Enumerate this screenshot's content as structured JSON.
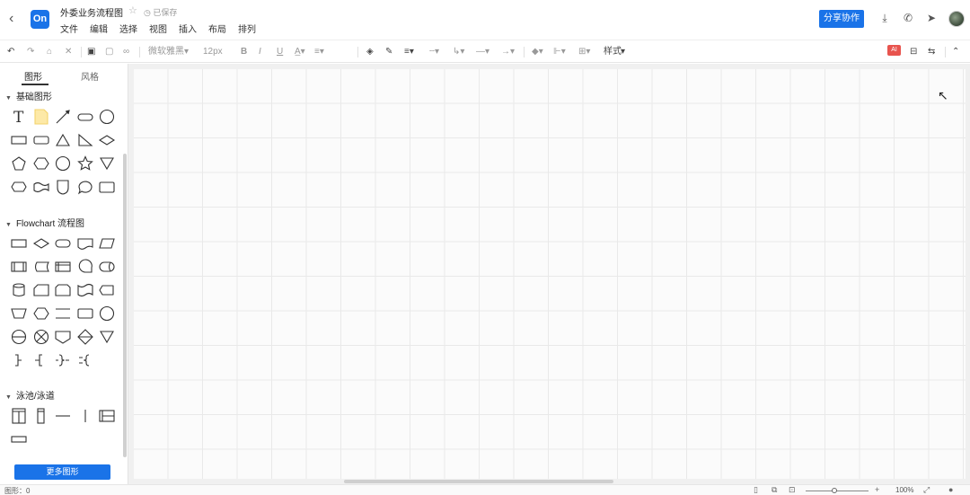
{
  "header": {
    "back_icon": "‹",
    "logo_text": "On",
    "doc_title": "外委业务流程图",
    "star_icon": "☆",
    "saved_text": "◷ 已保存",
    "menu": [
      "文件",
      "编辑",
      "选择",
      "视图",
      "插入",
      "布局",
      "排列"
    ],
    "share_label": "分享协作",
    "icons": [
      "download-icon",
      "phone-icon",
      "send-icon"
    ]
  },
  "toolbar": {
    "font_name": "微软雅黑",
    "font_size": "12px",
    "style_label": "样式",
    "ai_label": "AI"
  },
  "sidebar": {
    "tabs": [
      "图形",
      "风格"
    ],
    "sections": [
      "基础图形",
      "Flowchart 流程图",
      "泳池/泳道"
    ],
    "more_label": "更多图形"
  },
  "status": {
    "shapes_count": "图形：0",
    "zoom": "100%"
  }
}
